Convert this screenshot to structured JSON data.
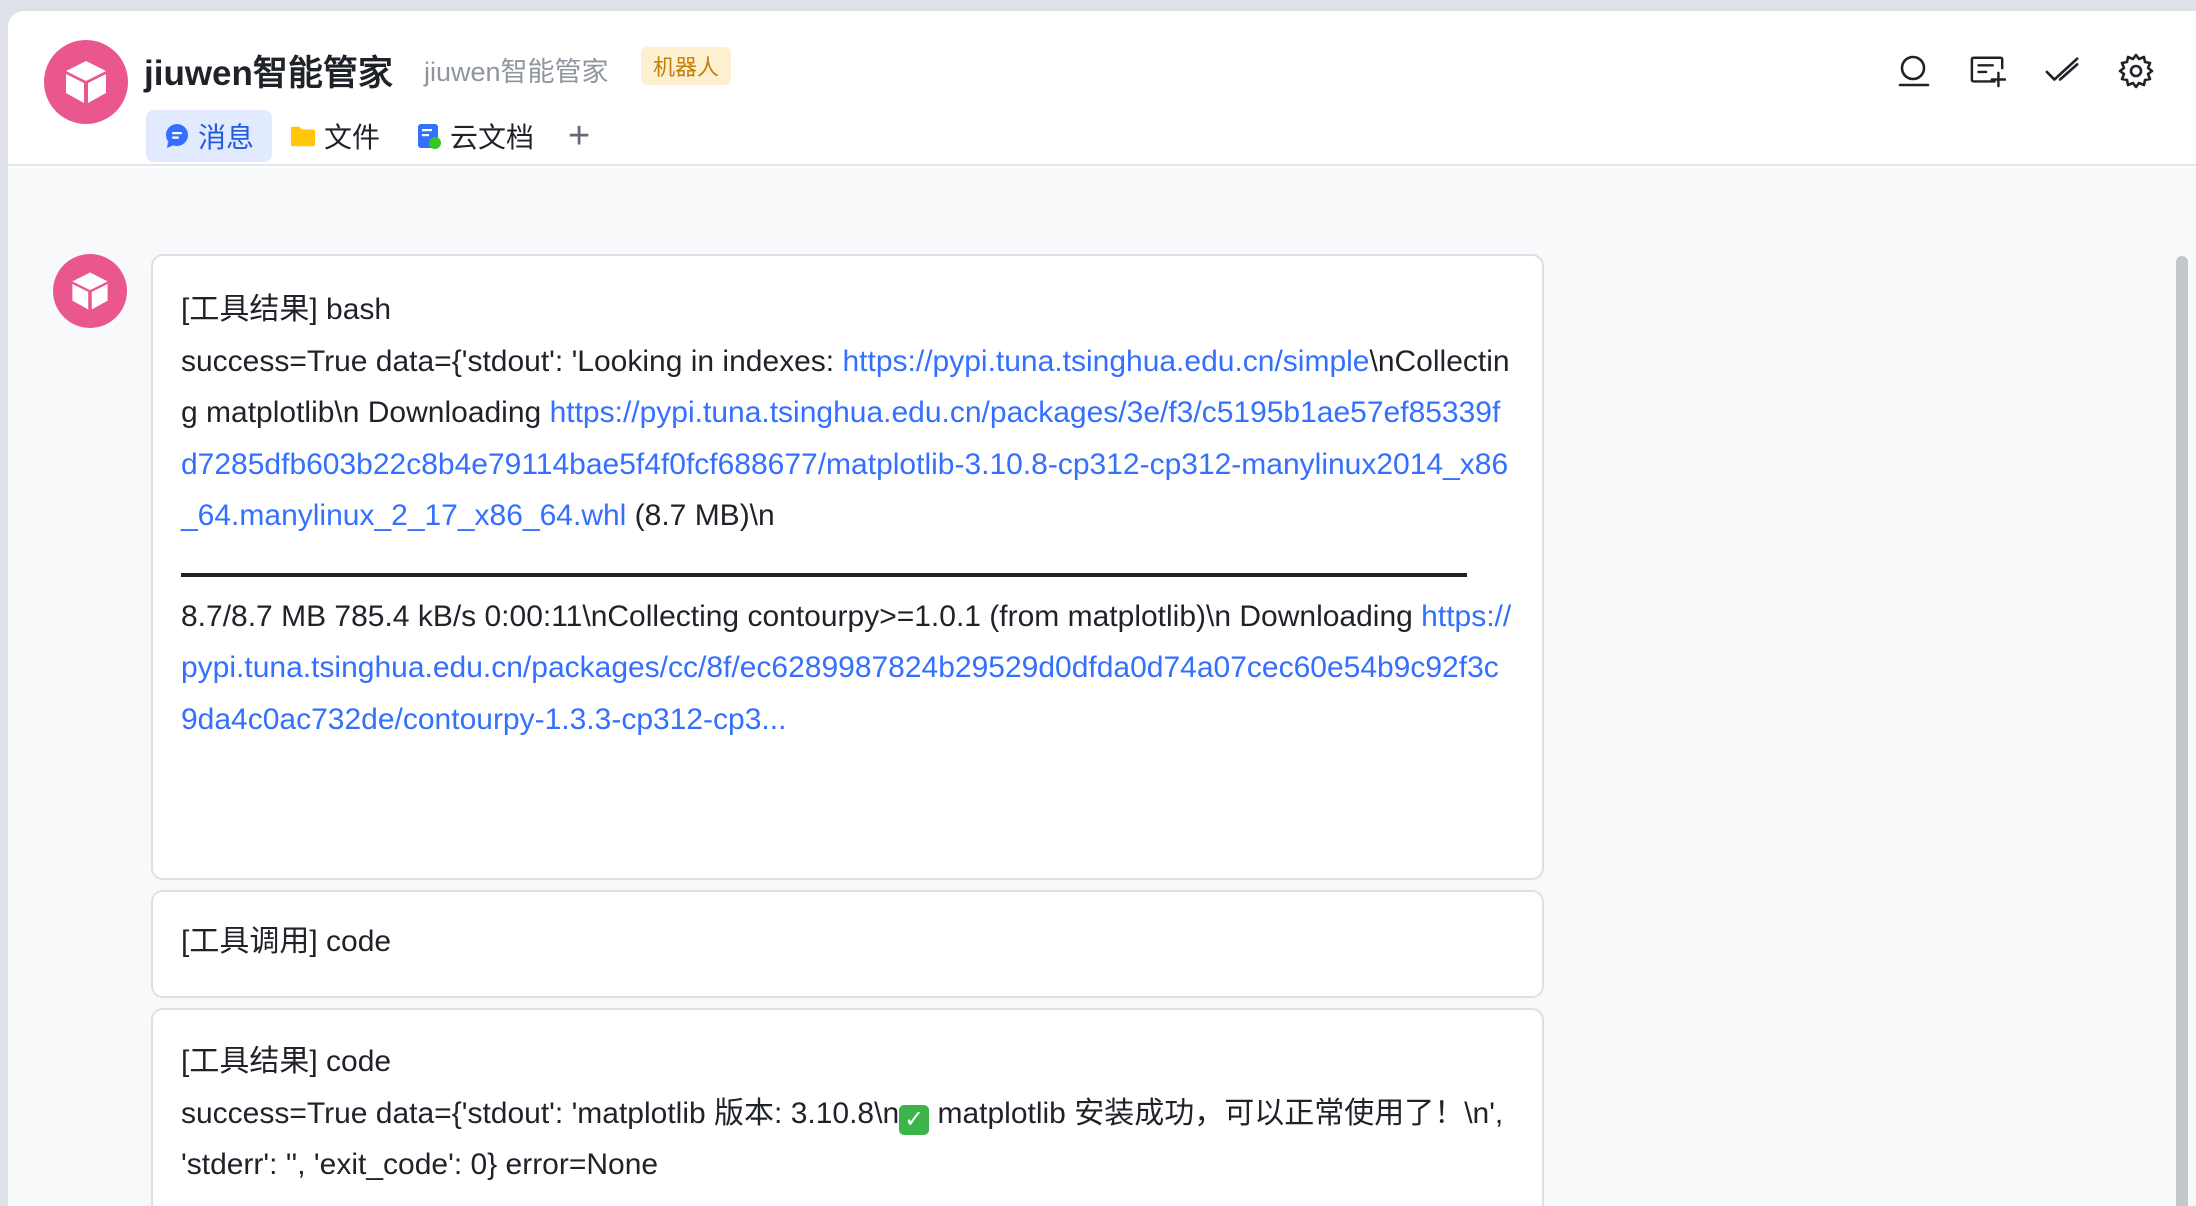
{
  "header": {
    "title": "jiuwen智能管家",
    "subtitle": "jiuwen智能管家",
    "badge": "机器人",
    "tabs": [
      {
        "label": "消息",
        "icon": "chat-bubble-icon",
        "active": true
      },
      {
        "label": "文件",
        "icon": "folder-icon",
        "active": false
      },
      {
        "label": "云文档",
        "icon": "cloud-doc-icon",
        "active": false
      }
    ],
    "add_tab_label": "+",
    "actions": [
      "search-icon",
      "add-card-icon",
      "check-mark-icon",
      "gear-icon"
    ]
  },
  "colors": {
    "avatar": "#e9578e",
    "link": "#3370ff",
    "active_tab_bg": "#e1eaff",
    "badge_bg": "#fdf0d0",
    "badge_fg": "#c28008"
  },
  "messages": [
    {
      "heading": "[工具结果] bash",
      "line1": "success=True data={'stdout': 'Looking in indexes:",
      "link1": "https://pypi.tuna.tsinghua.edu.cn/simple",
      "text1": "\\nCollecting matplotlib\\n  Downloading",
      "link2": "https://pypi.tuna.tsinghua.edu.cn/packages/3e/f3/c5195b1ae57ef85339fd7285dfb603b22c8b4e79114bae5f4f0fcf688677/matplotlib-3.10.8-cp312-cp312-manylinux2014_x86_64.manylinux_2_17_x86_64.whl",
      "text2": " (8.7 MB)\\n",
      "line2": "8.7/8.7 MB 785.4 kB/s  0:00:11\\nCollecting contourpy>=1.0.1 (from matplotlib)\\n Downloading",
      "link3": "https://pypi.tuna.tsinghua.edu.cn/packages/cc/8f/ec6289987824b29529d0dfda0d74a07cec60e54b9c92f3c9da4c0ac732de/contourpy-1.3.3-cp312-cp3..."
    },
    {
      "heading": "[工具调用] code"
    },
    {
      "heading": "[工具结果] code",
      "line1a": "success=True data={'stdout': 'matplotlib 版本: 3.10.8\\n",
      "check_glyph": "✓",
      "line1b": " matplotlib 安装成功，可以正常使用了！\\n', 'stderr': '', 'exit_code': 0} error=None"
    }
  ]
}
